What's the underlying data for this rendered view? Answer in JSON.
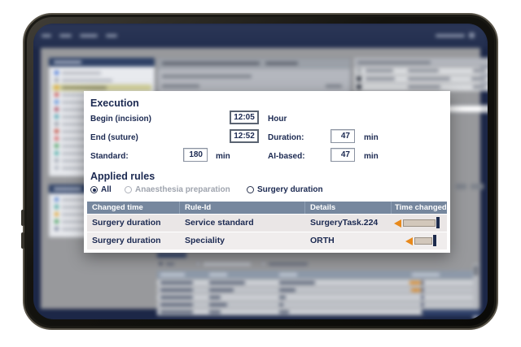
{
  "colors": {
    "accent_orange": "#E8891B",
    "navy_text": "#1B2951",
    "table_header_bg": "#76879E",
    "row_bg": "#EAE6E6",
    "row_alt_bg": "#F0EDED",
    "screen_navy": "#1C2747",
    "content_grey": "#98999C"
  },
  "overlay": {
    "execution": {
      "title": "Execution",
      "begin_label": "Begin (incision)",
      "begin_value": "12:05",
      "begin_unit": "Hour",
      "end_label": "End (suture)",
      "end_value": "12:52",
      "duration_label": "Duration:",
      "duration_value": "47",
      "duration_unit": "min",
      "standard_label": "Standard:",
      "standard_value": "180",
      "standard_unit": "min",
      "ai_label": "AI-based:",
      "ai_value": "47",
      "ai_unit": "min"
    },
    "applied_rules": {
      "title": "Applied rules",
      "filters": [
        {
          "label": "All",
          "state": "selected"
        },
        {
          "label": "Anaesthesia preparation",
          "state": "disabled"
        },
        {
          "label": "Surgery duration",
          "state": "unselected"
        }
      ],
      "table": {
        "headers": [
          "Changed time",
          "Rule-Id",
          "Details",
          "Time changed"
        ],
        "rows": [
          {
            "changed_time": "Surgery duration",
            "rule_id": "Service standard",
            "details": "SurgeryTask.224",
            "time_changed": "shift-left-large"
          },
          {
            "changed_time": "Surgery duration",
            "rule_id": "Speciality",
            "details": "ORTH",
            "time_changed": "shift-left-small"
          }
        ]
      }
    }
  }
}
